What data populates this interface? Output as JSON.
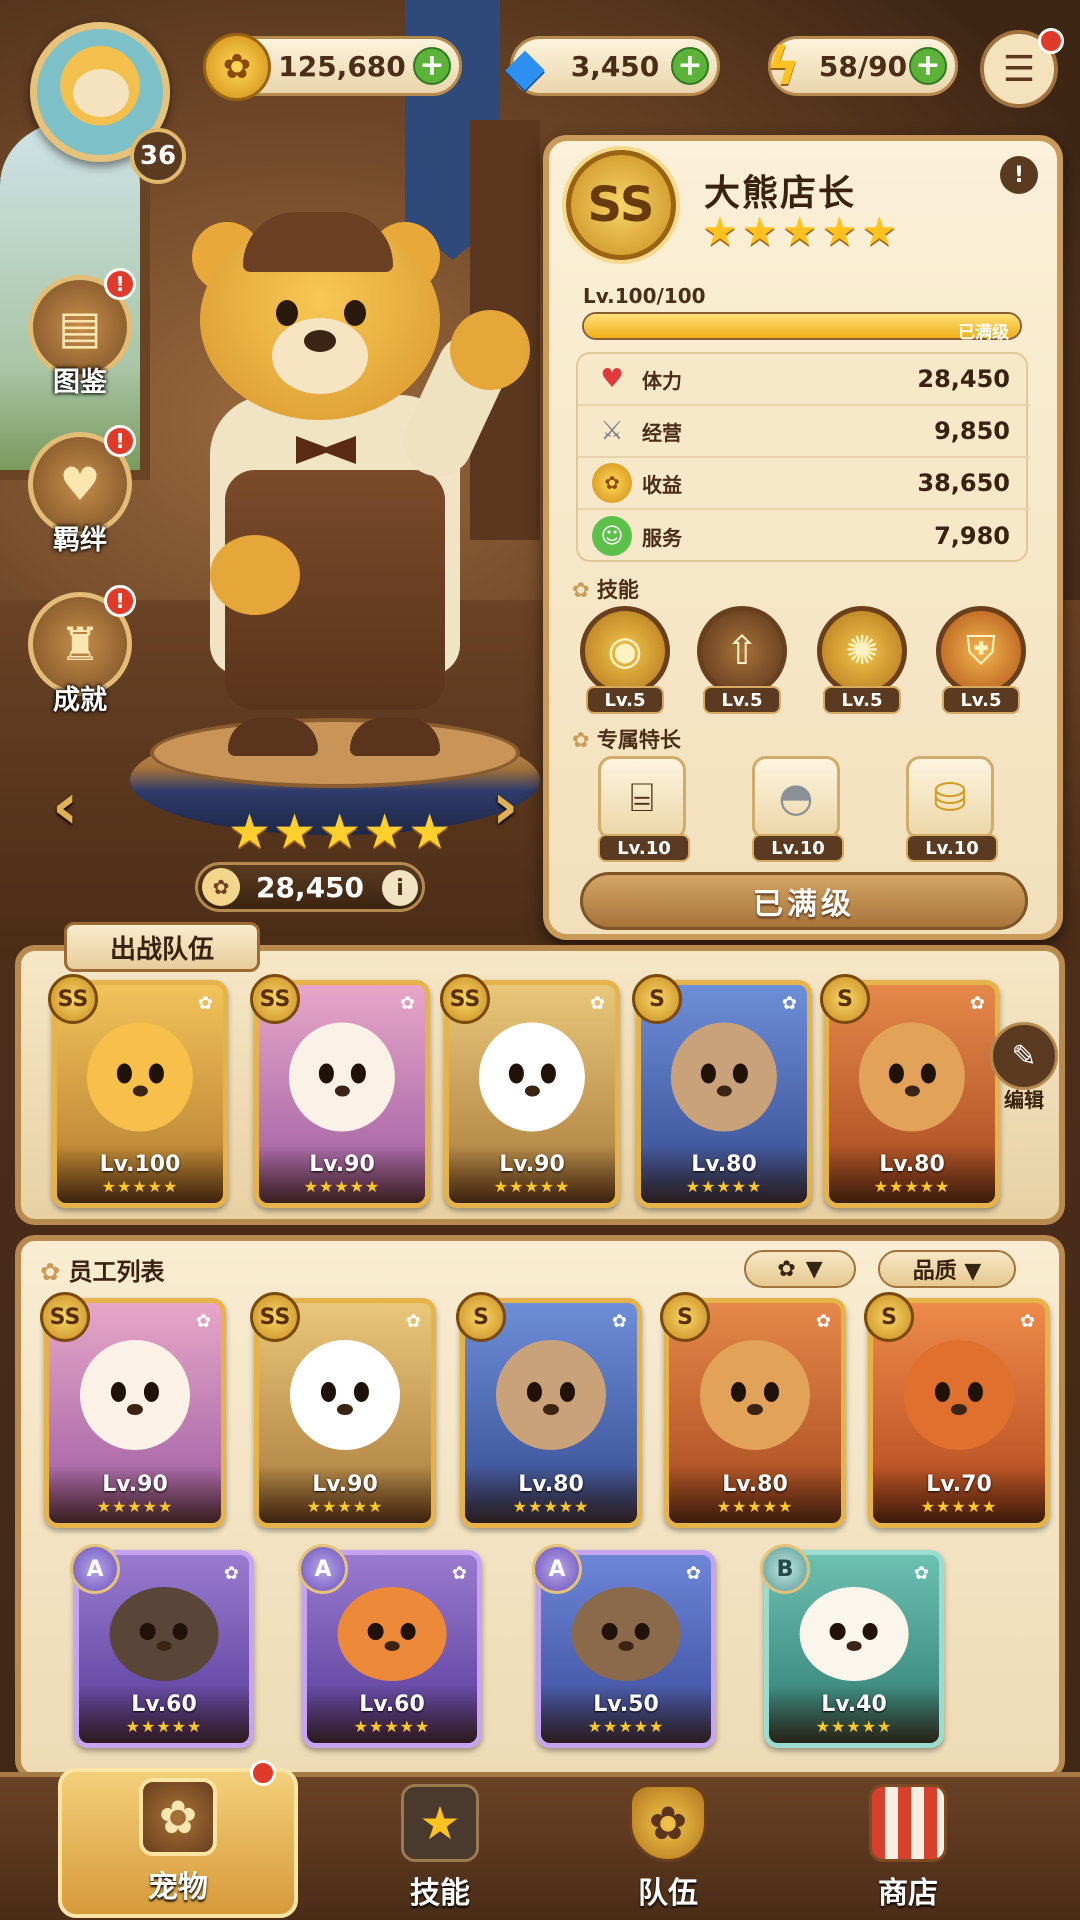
{
  "top_bar": {
    "player_level": "36",
    "resources": [
      {
        "name": "coins",
        "icon": "paw-coin-icon",
        "value": "125,680"
      },
      {
        "name": "gems",
        "icon": "diamond-icon",
        "value": "3,450"
      },
      {
        "name": "energy",
        "icon": "lightning-icon",
        "value": "58/90"
      }
    ],
    "plus_symbol": "+",
    "menu_icon": "hamburger-menu-icon"
  },
  "side_menu": [
    {
      "label": "图鉴",
      "icon": "book-icon",
      "badge": "!"
    },
    {
      "label": "羁绊",
      "icon": "heart-paw-icon",
      "badge": "!"
    },
    {
      "label": "成就",
      "icon": "trophy-icon",
      "badge": "!"
    }
  ],
  "showcase": {
    "stars": "★★★★★",
    "power": "28,450",
    "prev_arrow": "‹",
    "next_arrow": "›"
  },
  "detail": {
    "rank": "SS",
    "name": "大熊店长",
    "stars": "★★★★★",
    "level_text": "Lv.100/100",
    "level_progress": 1.0,
    "max_label": "已满级",
    "info_symbol": "!",
    "stats": [
      {
        "label": "体力",
        "value": "28,450",
        "icon": "heart-icon",
        "color": "#e03a3a"
      },
      {
        "label": "经营",
        "value": "9,850",
        "icon": "sword-icon",
        "color": "#7a7f8a"
      },
      {
        "label": "收益",
        "value": "38,650",
        "icon": "coin-icon",
        "color": "#e3a51e"
      },
      {
        "label": "服务",
        "value": "7,980",
        "icon": "smile-icon",
        "color": "#4caf3a"
      }
    ],
    "skills_title": "技能",
    "skills": [
      {
        "icon": "coin-pile-icon",
        "level": "Lv.5"
      },
      {
        "icon": "team-up-arrow-icon",
        "level": "Lv.5"
      },
      {
        "icon": "paw-burst-icon",
        "level": "Lv.5"
      },
      {
        "icon": "paw-shield-icon",
        "level": "Lv.5"
      }
    ],
    "traits_title": "专属特长",
    "traits": [
      {
        "icon": "cash-register-icon",
        "level": "Lv.10"
      },
      {
        "icon": "serving-cloche-icon",
        "level": "Lv.10"
      },
      {
        "icon": "treasure-coins-icon",
        "level": "Lv.10"
      }
    ],
    "max_button": "已满级"
  },
  "team": {
    "title": "出战队伍",
    "edit_label": "编辑",
    "members": [
      {
        "rank": "SS",
        "animal": "bear",
        "level": "Lv.100",
        "stars": "★★★★★"
      },
      {
        "rank": "SS",
        "animal": "bunny",
        "level": "Lv.90",
        "stars": "★★★★★"
      },
      {
        "rank": "SS",
        "animal": "panda",
        "level": "Lv.90",
        "stars": "★★★★★"
      },
      {
        "rank": "S",
        "animal": "cat",
        "level": "Lv.80",
        "stars": "★★★★★"
      },
      {
        "rank": "S",
        "animal": "dog",
        "level": "Lv.80",
        "stars": "★★★★★"
      }
    ]
  },
  "roster": {
    "title": "员工列表",
    "filter_paw": "▼",
    "filter_quality": "品质 ▼",
    "staff": [
      {
        "rank": "SS",
        "animal": "bunny",
        "level": "Lv.90",
        "stars": "★★★★★"
      },
      {
        "rank": "SS",
        "animal": "panda",
        "level": "Lv.90",
        "stars": "★★★★★"
      },
      {
        "rank": "S",
        "animal": "cat",
        "level": "Lv.80",
        "stars": "★★★★★"
      },
      {
        "rank": "S",
        "animal": "dog",
        "level": "Lv.80",
        "stars": "★★★★★"
      },
      {
        "rank": "S",
        "animal": "dragon",
        "level": "Lv.70",
        "stars": "★★★★★"
      },
      {
        "rank": "A",
        "animal": "mole",
        "level": "Lv.60",
        "stars": "★★★★★"
      },
      {
        "rank": "A",
        "animal": "fox",
        "level": "Lv.60",
        "stars": "★★★★★"
      },
      {
        "rank": "A",
        "animal": "owl",
        "level": "Lv.50",
        "stars": "★★★★★"
      },
      {
        "rank": "B",
        "animal": "sheep",
        "level": "Lv.40",
        "stars": "★★★★★"
      }
    ]
  },
  "bottom_nav": [
    {
      "label": "宠物",
      "icon": "paw-icon",
      "active": true
    },
    {
      "label": "技能",
      "icon": "star-book-icon",
      "active": false
    },
    {
      "label": "队伍",
      "icon": "paw-shield-icon",
      "active": false
    },
    {
      "label": "商店",
      "icon": "shop-awning-icon",
      "active": false
    }
  ]
}
